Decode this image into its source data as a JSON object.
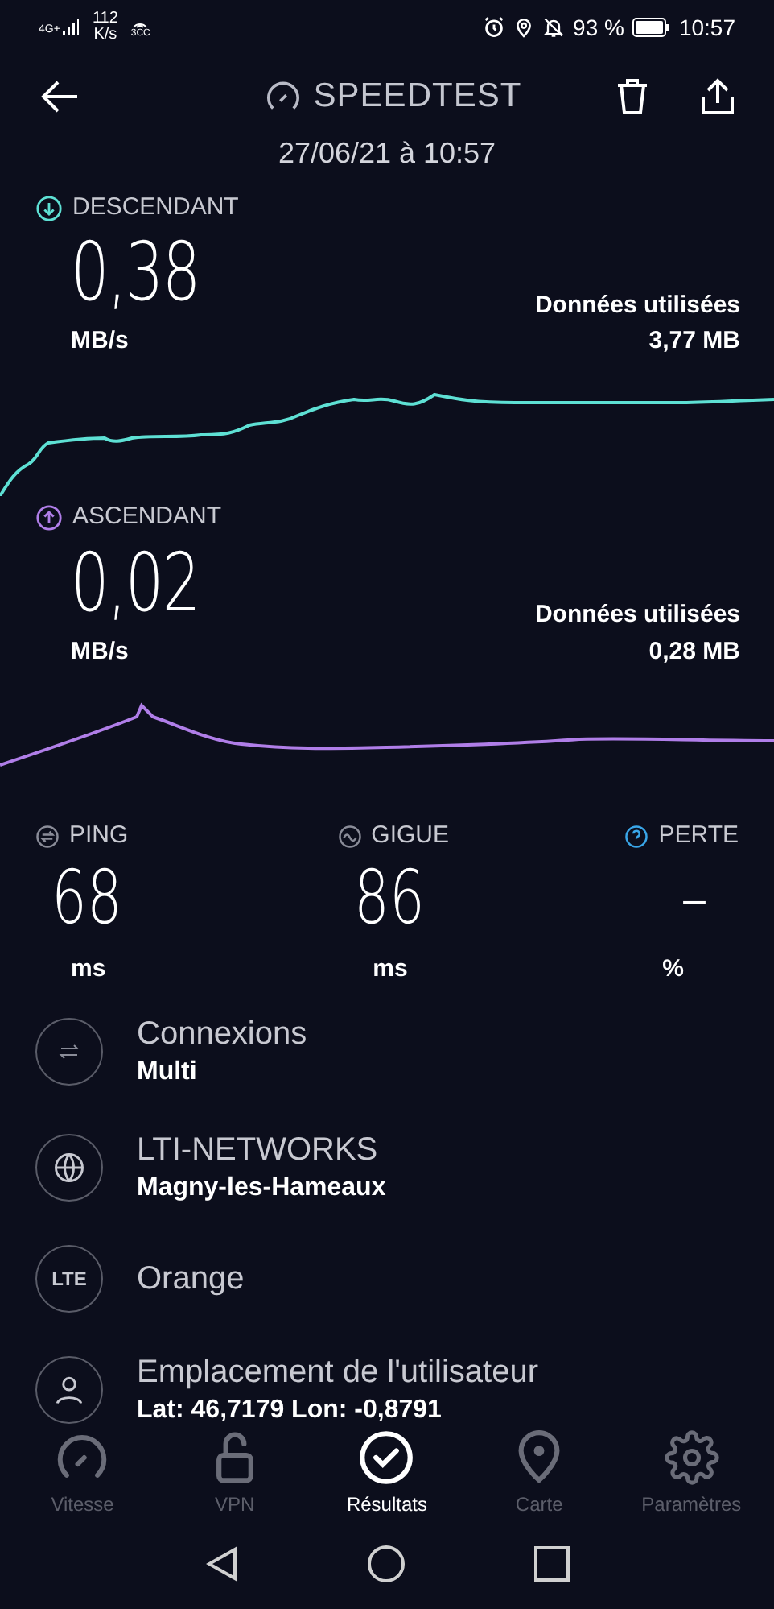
{
  "status_bar": {
    "network": "4G+",
    "speed_value": "112",
    "speed_unit": "K/s",
    "hotspot": "3CC",
    "battery": "93 %",
    "time": "10:57"
  },
  "header": {
    "title": "SPEEDTEST",
    "date": "27/06/21 à 10:57"
  },
  "tests": [
    {
      "kind": "download",
      "label": "DESCENDANT",
      "value": "0,38",
      "unit": "MB/s",
      "data_label": "Données utilisées",
      "data_value": "3,77 MB",
      "color": "#5ee0d4"
    },
    {
      "kind": "upload",
      "label": "ASCENDANT",
      "value": "0,02",
      "unit": "MB/s",
      "data_label": "Données utilisées",
      "data_value": "0,28 MB",
      "color": "#b07ee8"
    }
  ],
  "metrics": [
    {
      "kind": "ping",
      "label": "PING",
      "value": "68",
      "unit": "ms"
    },
    {
      "kind": "jitter",
      "label": "GIGUE",
      "value": "86",
      "unit": "ms"
    },
    {
      "kind": "loss",
      "label": "PERTE",
      "value": "–",
      "unit": "%"
    }
  ],
  "details": [
    {
      "kind": "connections",
      "title": "Connexions",
      "subtitle": "Multi"
    },
    {
      "kind": "server",
      "title": "LTI-NETWORKS",
      "subtitle": "Magny-les-Hameaux"
    },
    {
      "kind": "lte",
      "badge": "LTE",
      "title": "Orange"
    },
    {
      "kind": "location",
      "title": "Emplacement de l'utilisateur",
      "subtitle": "Lat: 46,7179 Lon: -0,8791"
    }
  ],
  "tabs": [
    {
      "kind": "speed",
      "label": "Vitesse",
      "selected": false
    },
    {
      "kind": "vpn",
      "label": "VPN",
      "selected": false
    },
    {
      "kind": "results",
      "label": "Résultats",
      "selected": true
    },
    {
      "kind": "map",
      "label": "Carte",
      "selected": false
    },
    {
      "kind": "settings",
      "label": "Paramètres",
      "selected": false
    }
  ]
}
